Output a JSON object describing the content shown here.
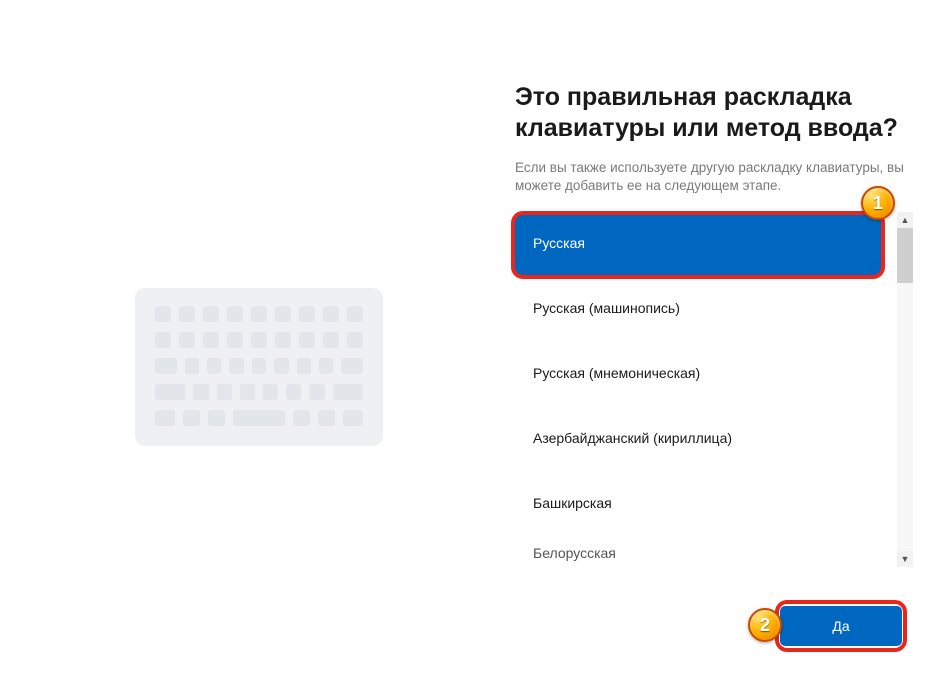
{
  "heading": "Это правильная раскладка клавиатуры или метод ввода?",
  "sub": "Если вы также используете другую раскладку клавиатуры, вы можете добавить ее на следующем этапе.",
  "layouts": [
    {
      "label": "Русская",
      "selected": true
    },
    {
      "label": "Русская (машинопись)",
      "selected": false
    },
    {
      "label": "Русская (мнемоническая)",
      "selected": false
    },
    {
      "label": "Азербайджанский (кириллица)",
      "selected": false
    },
    {
      "label": "Башкирская",
      "selected": false
    },
    {
      "label": "Белорусская",
      "selected": false
    }
  ],
  "yes": "Да",
  "badges": {
    "one": "1",
    "two": "2"
  },
  "colors": {
    "accent": "#0067c0",
    "anno": "#e8261c"
  }
}
